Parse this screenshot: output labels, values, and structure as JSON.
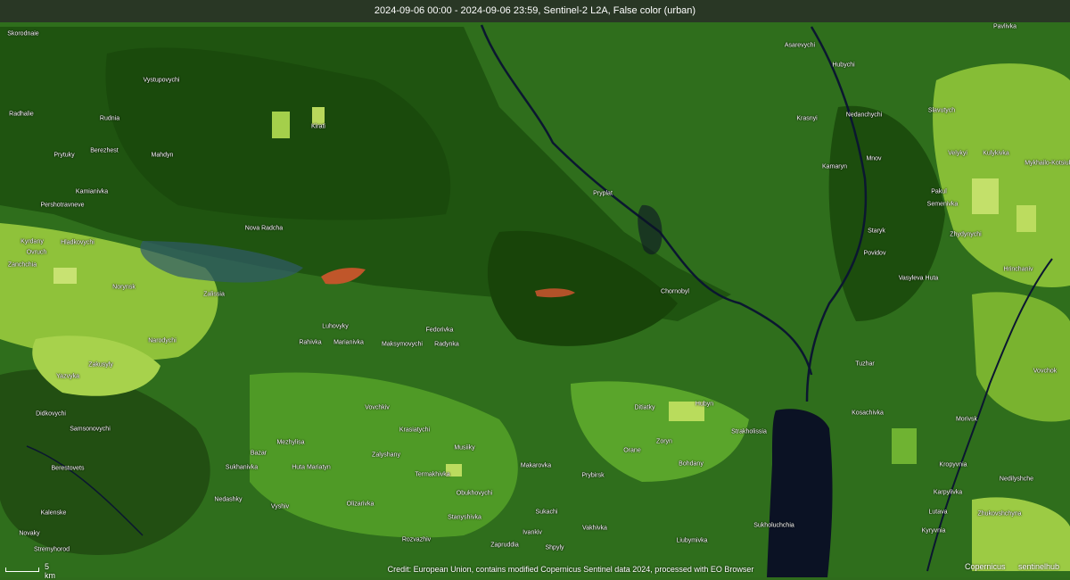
{
  "header": {
    "title": "2024-09-06 00:00 - 2024-09-06 23:59, Sentinel-2 L2A, False color (urban)"
  },
  "footer": {
    "scale_label": "5 km",
    "credit": "Credit: European Union, contains modified Copernicus Sentinel data 2024, processed with EO Browser",
    "logo_copernicus": "Copernicus",
    "logo_sentinelhub": "sentinelhub"
  },
  "colors": {
    "forest_dark": "#1d4d0e",
    "vegetation": "#3f8f1f",
    "fields": "#a9d54a",
    "water": "#0b1224",
    "burn": "#c0562a"
  },
  "places": [
    {
      "name": "Skorodnaie"
    },
    {
      "name": "Vystupovychi"
    },
    {
      "name": "Radhalie"
    },
    {
      "name": "Rudnia"
    },
    {
      "name": "Kirati"
    },
    {
      "name": "Prytuky"
    },
    {
      "name": "Berezhest"
    },
    {
      "name": "Mahdyn"
    },
    {
      "name": "Kamianivka"
    },
    {
      "name": "Pershotravneve"
    },
    {
      "name": "Nova Radcha"
    },
    {
      "name": "Kyrdany"
    },
    {
      "name": "Hladkovychi"
    },
    {
      "name": "Ovruch"
    },
    {
      "name": "Zanchchia"
    },
    {
      "name": "Norynsk"
    },
    {
      "name": "Zalissia"
    },
    {
      "name": "Pryplat"
    },
    {
      "name": "Chornobyl"
    },
    {
      "name": "Narodychi"
    },
    {
      "name": "Luhovyky"
    },
    {
      "name": "Rahivka"
    },
    {
      "name": "Marianivka"
    },
    {
      "name": "Maksymovychi"
    },
    {
      "name": "Radynka"
    },
    {
      "name": "Fedorivka"
    },
    {
      "name": "Zakusyly"
    },
    {
      "name": "Yazvyka"
    },
    {
      "name": "Didkovychi"
    },
    {
      "name": "Vovchkiv"
    },
    {
      "name": "Samsonovychi"
    },
    {
      "name": "Mezhylisa"
    },
    {
      "name": "Krasiatychi"
    },
    {
      "name": "Musiiky"
    },
    {
      "name": "Berestovets"
    },
    {
      "name": "Bazar"
    },
    {
      "name": "Sukhanivka"
    },
    {
      "name": "Huta Mariatyn"
    },
    {
      "name": "Zalyshany"
    },
    {
      "name": "Termakhivka"
    },
    {
      "name": "Ditiatky"
    },
    {
      "name": "Hubyn"
    },
    {
      "name": "Strakholissia"
    },
    {
      "name": "Zoryn"
    },
    {
      "name": "Orane"
    },
    {
      "name": "Bohdany"
    },
    {
      "name": "Makarovka"
    },
    {
      "name": "Obukhovychi"
    },
    {
      "name": "Prybirsk"
    },
    {
      "name": "Kalenske"
    },
    {
      "name": "Nedashky"
    },
    {
      "name": "Vyshiv"
    },
    {
      "name": "Olizarivka"
    },
    {
      "name": "Stanyshivka"
    },
    {
      "name": "Ivankiv"
    },
    {
      "name": "Sukachi"
    },
    {
      "name": "Vakhivka"
    },
    {
      "name": "Liubymivka"
    },
    {
      "name": "Sukholuchchia"
    },
    {
      "name": "Novaky"
    },
    {
      "name": "Stremyhorod"
    },
    {
      "name": "Rozvazhiv"
    },
    {
      "name": "Zapruddia"
    },
    {
      "name": "Shpyly"
    },
    {
      "name": "Asarevychi"
    },
    {
      "name": "Hubychi"
    },
    {
      "name": "Krasnyi"
    },
    {
      "name": "Nedanchychi"
    },
    {
      "name": "Slavutych"
    },
    {
      "name": "Pavlivka"
    },
    {
      "name": "Kamaryn"
    },
    {
      "name": "Mnov"
    },
    {
      "name": "Velykyi"
    },
    {
      "name": "Kulykivka"
    },
    {
      "name": "Mykhailo-Kotsiubynske"
    },
    {
      "name": "Pakul"
    },
    {
      "name": "Semenivka"
    },
    {
      "name": "Zhydynychi"
    },
    {
      "name": "Staryk"
    },
    {
      "name": "Povidov"
    },
    {
      "name": "Vasyleva Huta"
    },
    {
      "name": "Hrinchaniv"
    },
    {
      "name": "Tuzhar"
    },
    {
      "name": "Kosachivka"
    },
    {
      "name": "Morivsk"
    },
    {
      "name": "Kropyvnia"
    },
    {
      "name": "Karpylivka"
    },
    {
      "name": "Lutava"
    },
    {
      "name": "Zhukovshchyna"
    },
    {
      "name": "Kyryvnia"
    },
    {
      "name": "Vovchok"
    },
    {
      "name": "Nedilyshche"
    }
  ]
}
